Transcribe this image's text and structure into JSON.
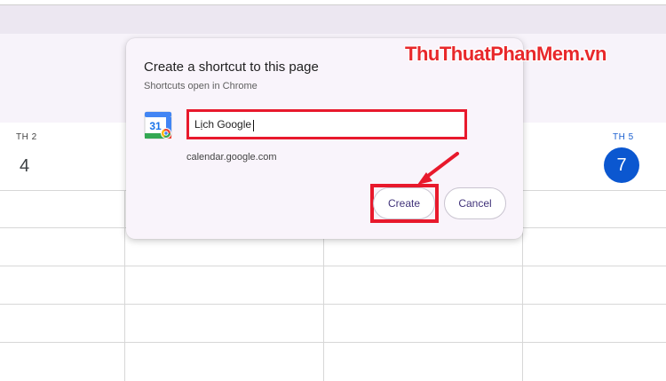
{
  "dialog": {
    "title": "Create a shortcut to this page",
    "subtitle": "Shortcuts open in Chrome",
    "name_value": "Lịch Google",
    "url": "calendar.google.com",
    "create_label": "Create",
    "cancel_label": "Cancel",
    "app_icon_text": "31"
  },
  "calendar": {
    "days": [
      {
        "label": "TH 2",
        "number": "4"
      },
      {
        "label": "TH 5",
        "number": "7",
        "today": true
      }
    ]
  },
  "watermark": "ThuThuatPhanMem.vn",
  "colors": {
    "highlight": "#e8192c",
    "today_blue": "#0b57d0",
    "dialog_bg": "#f9f4fb"
  }
}
